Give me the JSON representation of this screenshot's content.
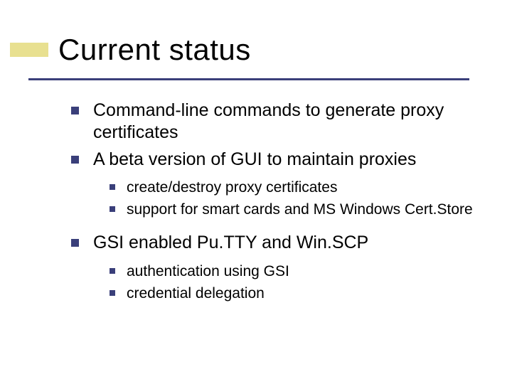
{
  "title": "Current status",
  "bullets": {
    "b1": "Command-line commands to generate proxy certificates",
    "b2": "A beta version of GUI to maintain proxies",
    "b2_sub": {
      "s1": "create/destroy proxy certificates",
      "s2": "support for smart cards and MS Windows Cert.Store"
    },
    "b3": "GSI enabled Pu.TTY and Win.SCP",
    "b3_sub": {
      "s1": "authentication using GSI",
      "s2": "credential delegation"
    }
  }
}
